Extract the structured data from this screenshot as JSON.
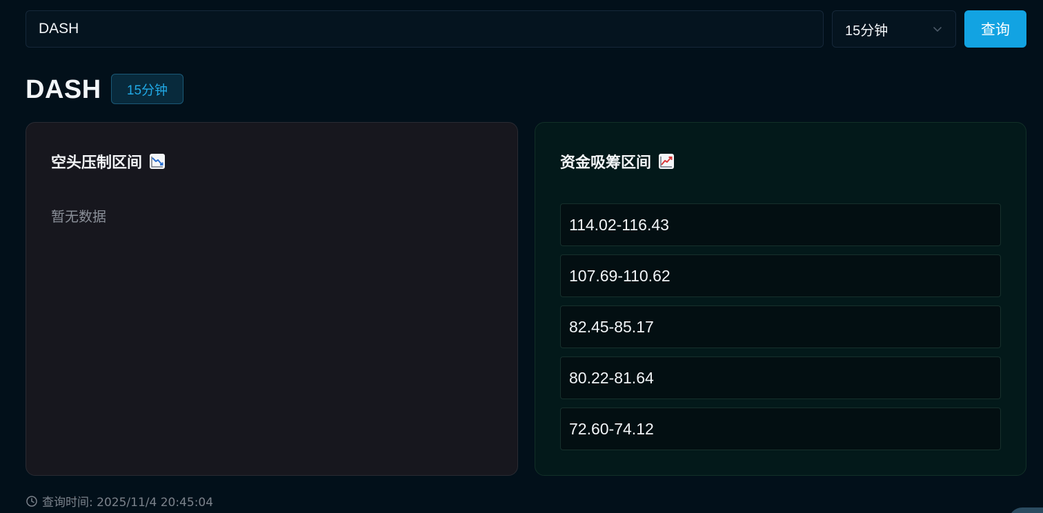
{
  "query": {
    "symbol_value": "DASH",
    "interval_selected": "15分钟",
    "submit_label": "查询"
  },
  "header": {
    "symbol": "DASH",
    "interval_badge": "15分钟"
  },
  "short_panel": {
    "title": "空头压制区间",
    "icon": "chart-decreasing-icon",
    "empty_text": "暂无数据"
  },
  "long_panel": {
    "title": "资金吸筹区间",
    "icon": "chart-increasing-icon",
    "zones": [
      "114.02-116.43",
      "107.69-110.62",
      "82.45-85.17",
      "80.22-81.64",
      "72.60-74.12"
    ]
  },
  "footer": {
    "query_time": "查询时间: 2025/11/4 20:45:04"
  },
  "colors": {
    "accent": "#12a3e2",
    "background": "#02101a",
    "short_panel_bg": "#17171e",
    "long_panel_bg": "#03191a"
  }
}
